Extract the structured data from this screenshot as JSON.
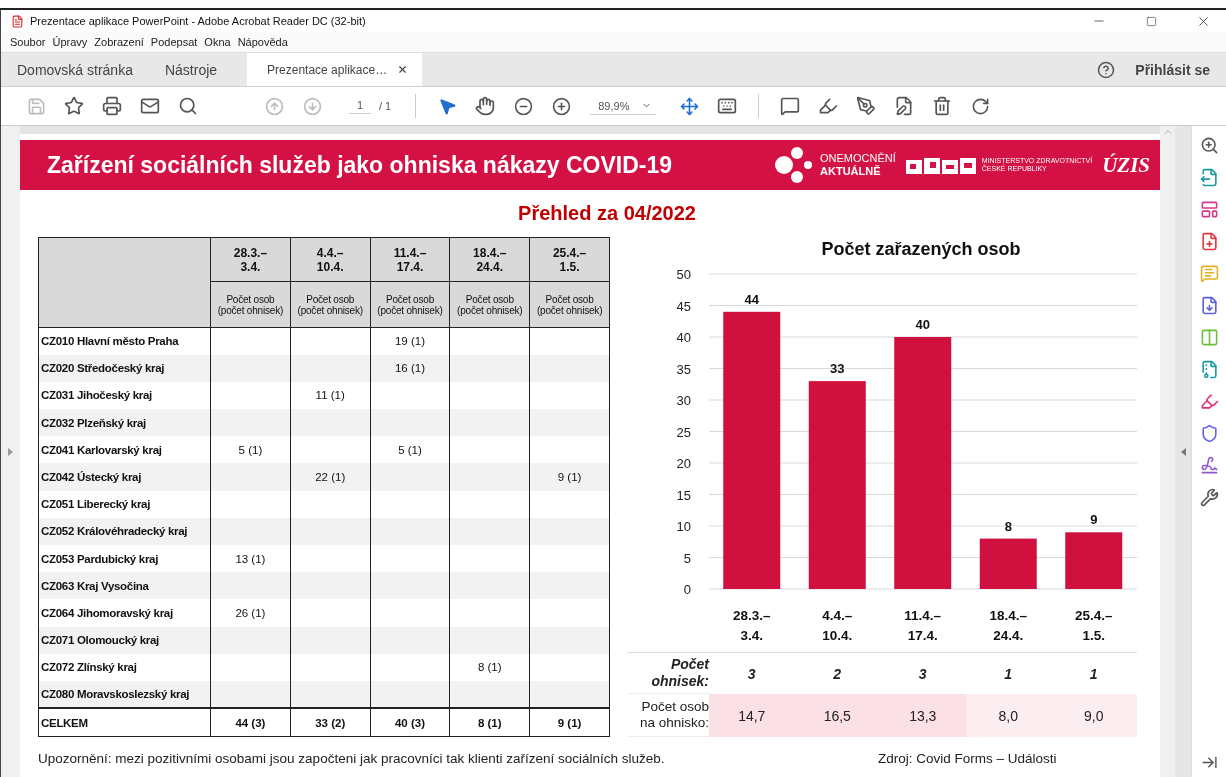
{
  "window": {
    "title": "Prezentace aplikace PowerPoint - Adobe Acrobat Reader DC (32-bit)"
  },
  "menu": [
    "Soubor",
    "Úpravy",
    "Zobrazení",
    "Podepsat",
    "Okna",
    "Nápověda"
  ],
  "tabs": [
    {
      "label": "Domovská stránka",
      "selected": false,
      "closable": false
    },
    {
      "label": "Nástroje",
      "selected": false,
      "closable": false
    },
    {
      "label": "Prezentace aplikace…",
      "selected": true,
      "closable": true
    }
  ],
  "sign_in": "Přihlásit se",
  "toolbar": {
    "page": "1",
    "page_count": "/ 1",
    "zoom": "89,9%"
  },
  "document": {
    "banner_title": "Zařízení sociálních služeb jako ohniska nákazy COVID-19",
    "logos": {
      "disease_top": "ONEMOCNĚNÍ",
      "disease_bottom": "AKTUÁLNĚ",
      "ministry_top": "MINISTERSTVO ZDRAVOTNICTVÍ",
      "ministry_bottom": "ČESKÉ REPUBLIKY",
      "institute": "ÚZIS"
    },
    "subtitle": "Přehled za 04/2022",
    "table": {
      "columns": [
        {
          "period": "28.3.–\n3.4.",
          "unit": "Počet osob\n(počet ohnisek)"
        },
        {
          "period": "4.4.–\n10.4.",
          "unit": "Počet osob\n(počet ohnisek)"
        },
        {
          "period": "11.4.–\n17.4.",
          "unit": "Počet osob\n(počet ohnisek)"
        },
        {
          "period": "18.4.–\n24.4.",
          "unit": "Počet osob\n(počet ohnisek)"
        },
        {
          "period": "25.4.–\n1.5.",
          "unit": "Počet osob\n(počet ohnisek)"
        }
      ],
      "rows": [
        {
          "region": "CZ010 Hlavní město Praha",
          "c3": "19 (1)"
        },
        {
          "region": "CZ020 Středočeský kraj",
          "c3": "16 (1)"
        },
        {
          "region": "CZ031 Jihočeský kraj",
          "c2": "11 (1)"
        },
        {
          "region": "CZ032 Plzeňský kraj"
        },
        {
          "region": "CZ041 Karlovarský kraj",
          "c1": "5 (1)",
          "c3": "5 (1)"
        },
        {
          "region": "CZ042 Ústecký kraj",
          "c2": "22 (1)",
          "c5": "9 (1)"
        },
        {
          "region": "CZ051 Liberecký kraj"
        },
        {
          "region": "CZ052 Královéhradecký kraj"
        },
        {
          "region": "CZ053 Pardubický kraj",
          "c1": "13 (1)"
        },
        {
          "region": "CZ063 Kraj Vysočina"
        },
        {
          "region": "CZ064 Jihomoravský kraj",
          "c1": "26 (1)"
        },
        {
          "region": "CZ071 Olomoucký kraj"
        },
        {
          "region": "CZ072 Zlínský kraj",
          "c4": "8 (1)"
        },
        {
          "region": "CZ080 Moravskoslezský kraj"
        }
      ],
      "total": {
        "region": "CELKEM",
        "c1": "44 (3)",
        "c2": "33 (2)",
        "c3": "40 (3)",
        "c4": "8 (1)",
        "c5": "9 (1)"
      }
    },
    "chart": {
      "chart_data": {
        "type": "bar",
        "title": "Počet zařazených osob",
        "categories": [
          "28.3.–\n3.4.",
          "4.4.–\n10.4.",
          "11.4.–\n17.4.",
          "18.4.–\n24.4.",
          "25.4.–\n1.5."
        ],
        "series": [
          {
            "color": "#d0103f",
            "values": [
              44,
              33,
              40,
              8,
              9
            ]
          }
        ],
        "ylim": [
          0,
          50
        ],
        "yticks": [
          0,
          5,
          10,
          15,
          20,
          25,
          30,
          35,
          40,
          45,
          50
        ],
        "grid": true,
        "data_labels": true
      }
    },
    "summary": [
      {
        "kind": "count",
        "label": "Počet ohnisek:",
        "values": [
          {
            "text": "3"
          },
          {
            "text": "2"
          },
          {
            "text": "3"
          },
          {
            "text": "1"
          },
          {
            "text": "1"
          }
        ]
      },
      {
        "kind": "ratio",
        "label": "Počet osob na ohnisko:",
        "values": [
          {
            "text": "14,7",
            "color": "#fbe1e5"
          },
          {
            "text": "16,5",
            "color": "#fbe1e5"
          },
          {
            "text": "13,3",
            "color": "#fbe1e5"
          },
          {
            "text": "8,0",
            "color": "#fcedf0"
          },
          {
            "text": "9,0",
            "color": "#fcedf0"
          }
        ]
      }
    ],
    "note": "Upozornění: mezi pozitivními osobami jsou započteni jak pracovníci tak klienti zařízení sociálních služeb.",
    "source": "Zdroj: Covid Forms – Události"
  }
}
